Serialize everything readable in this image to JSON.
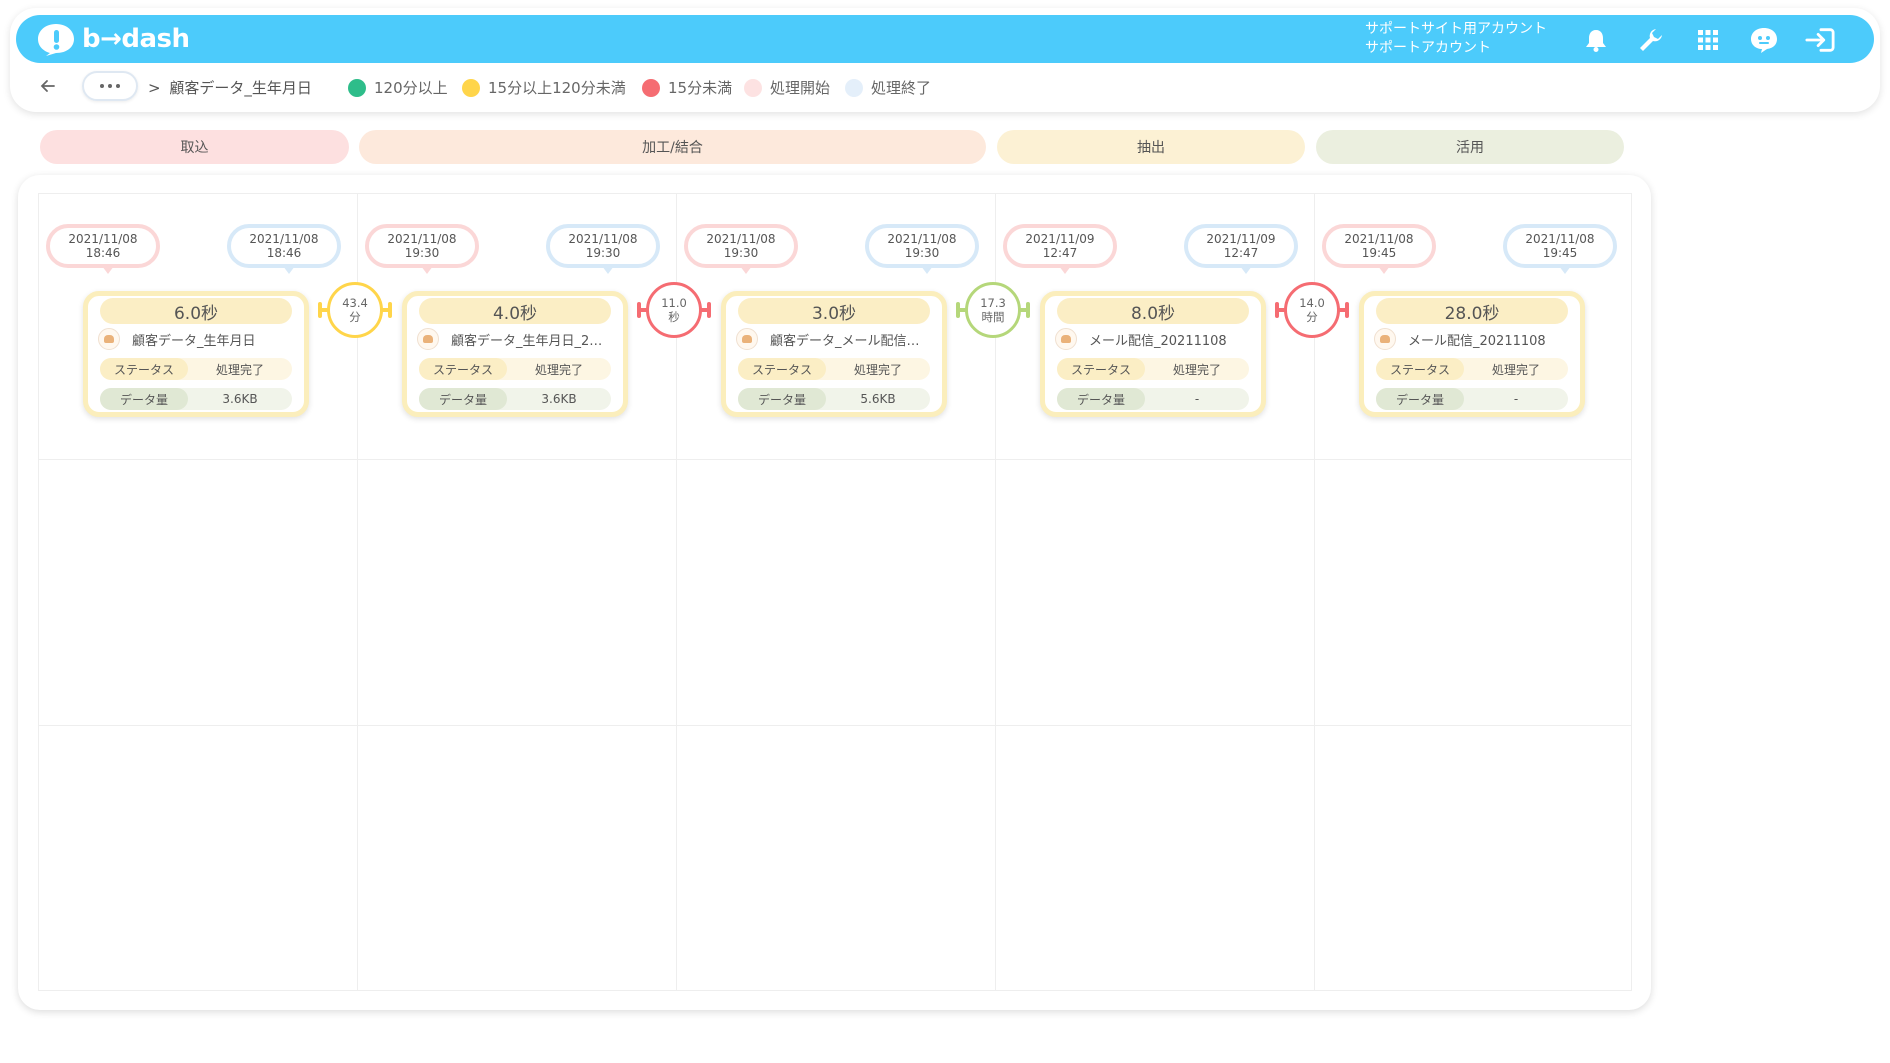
{
  "app": {
    "logo_text": "b→dash"
  },
  "header": {
    "account_line1": "サポートサイト用アカウント",
    "account_line2": "サポートアカウント"
  },
  "breadcrumb": {
    "separator": ">",
    "current": "顧客データ_生年月日"
  },
  "legend": [
    {
      "label": "120分以上",
      "color": "#2ebd8a"
    },
    {
      "label": "15分以上120分未満",
      "color": "#ffd54a"
    },
    {
      "label": "15分未満",
      "color": "#f56c72"
    },
    {
      "label": "処理開始",
      "color": "#fde2e2"
    },
    {
      "label": "処理終了",
      "color": "#e4effa"
    }
  ],
  "stages": [
    {
      "label": "取込",
      "color": "#fde0e0"
    },
    {
      "label": "加工/結合",
      "color": "#fde9dc"
    },
    {
      "label": "抽出",
      "color": "#fcf1d4"
    },
    {
      "label": "活用",
      "color": "#ebefdf"
    }
  ],
  "flow": {
    "status_key": "ステータス",
    "size_key": "データ量",
    "cards": [
      {
        "start_date": "2021/11/08",
        "start_time": "18:46",
        "end_date": "2021/11/08",
        "end_time": "18:46",
        "duration": "6.0秒",
        "name": "顧客データ_生年月日",
        "status": "処理完了",
        "size": "3.6KB"
      },
      {
        "start_date": "2021/11/08",
        "start_time": "19:30",
        "end_date": "2021/11/08",
        "end_time": "19:30",
        "duration": "4.0秒",
        "name": "顧客データ_生年月日_2…",
        "status": "処理完了",
        "size": "3.6KB"
      },
      {
        "start_date": "2021/11/08",
        "start_time": "19:30",
        "end_date": "2021/11/08",
        "end_time": "19:30",
        "duration": "3.0秒",
        "name": "顧客データ_メール配信…",
        "status": "処理完了",
        "size": "5.6KB"
      },
      {
        "start_date": "2021/11/09",
        "start_time": "12:47",
        "end_date": "2021/11/09",
        "end_time": "12:47",
        "duration": "8.0秒",
        "name": "メール配信_20211108",
        "status": "処理完了",
        "size": "-"
      },
      {
        "start_date": "2021/11/08",
        "start_time": "19:45",
        "end_date": "2021/11/08",
        "end_time": "19:45",
        "duration": "28.0秒",
        "name": "メール配信_20211108",
        "status": "処理完了",
        "size": "-"
      }
    ],
    "gaps": [
      {
        "value": "43.4",
        "unit": "分",
        "color": "#ffd54a"
      },
      {
        "value": "11.0",
        "unit": "秒",
        "color": "#f56c72"
      },
      {
        "value": "17.3",
        "unit": "時間",
        "color": "#b5d77a"
      },
      {
        "value": "14.0",
        "unit": "分",
        "color": "#f56c72"
      }
    ]
  }
}
